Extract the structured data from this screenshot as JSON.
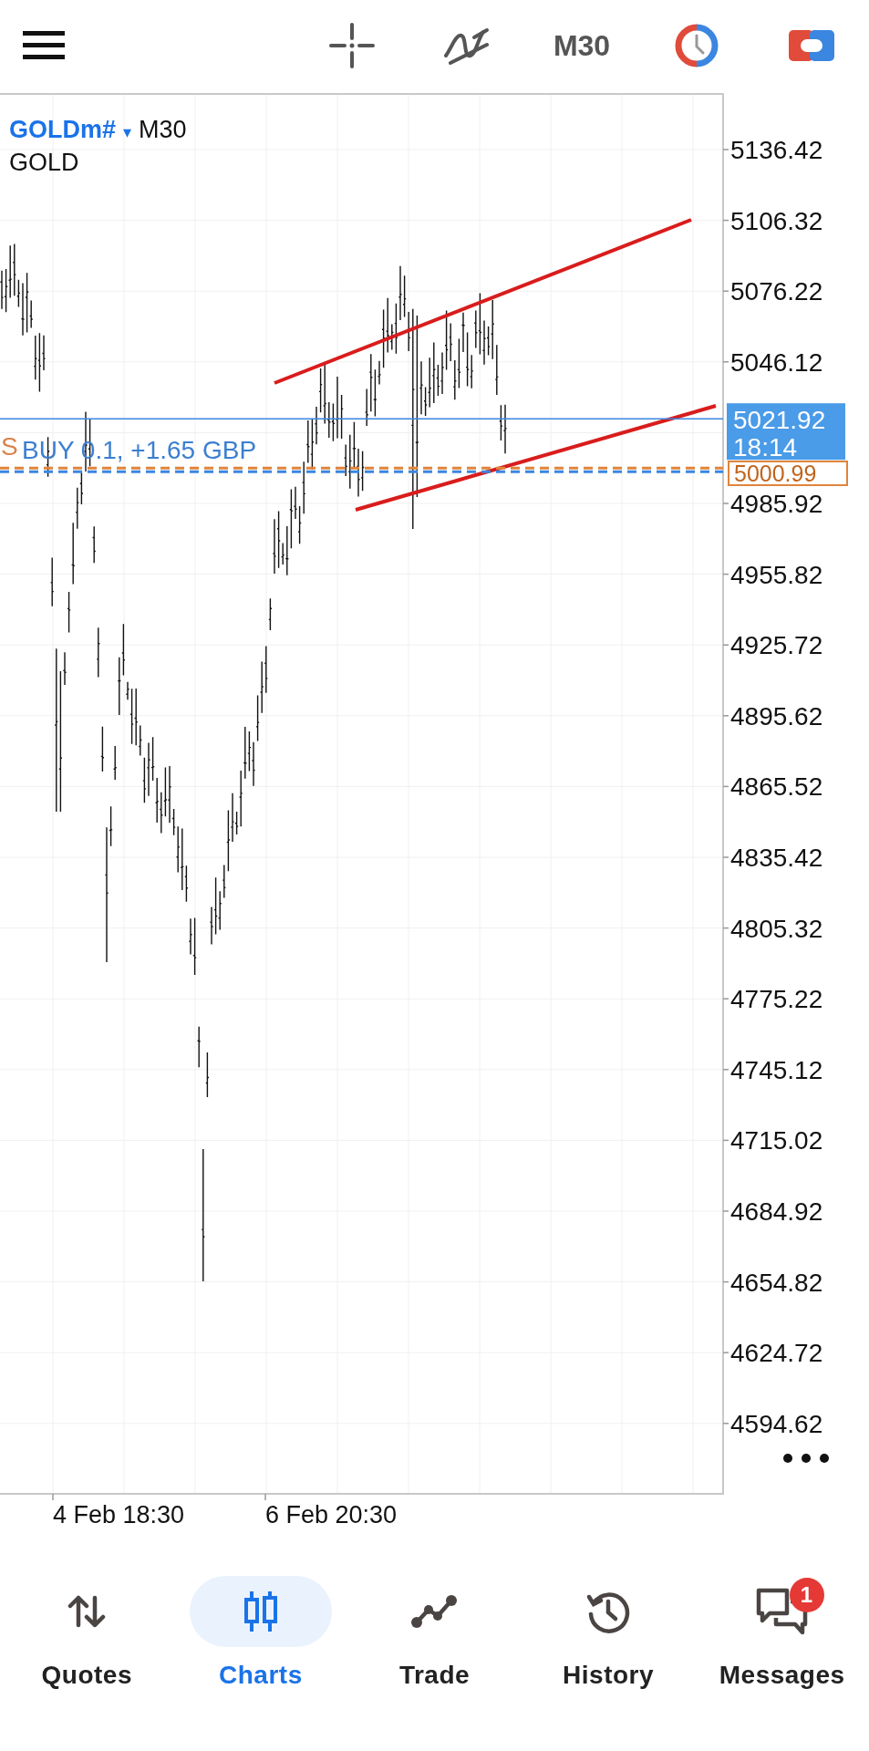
{
  "toolbar": {
    "timeframe": "M30"
  },
  "chart": {
    "symbol": "GOLDm#",
    "dropdown": "▾",
    "timeframe": "M30",
    "description": "GOLD",
    "price_labels": [
      "5136.42",
      "5106.32",
      "5076.22",
      "5046.12",
      "4985.92",
      "4955.82",
      "4925.72",
      "4895.62",
      "4865.52",
      "4835.42",
      "4805.32",
      "4775.22",
      "4745.12",
      "4715.02",
      "4684.92",
      "4654.82",
      "4624.72",
      "4594.62"
    ],
    "current_price": {
      "price": "5021.92",
      "countdown": "18:14"
    },
    "position": {
      "marker": "S",
      "label": "BUY 0.1,  +1.65 GBP",
      "open_price": "5000.99"
    },
    "time_labels": [
      "4 Feb 18:30",
      "6 Feb 20:30"
    ]
  },
  "nav": [
    {
      "label": "Quotes",
      "selected": false
    },
    {
      "label": "Charts",
      "selected": true
    },
    {
      "label": "Trade",
      "selected": false
    },
    {
      "label": "History",
      "selected": false
    },
    {
      "label": "Messages",
      "selected": false,
      "badge": "1"
    }
  ]
}
